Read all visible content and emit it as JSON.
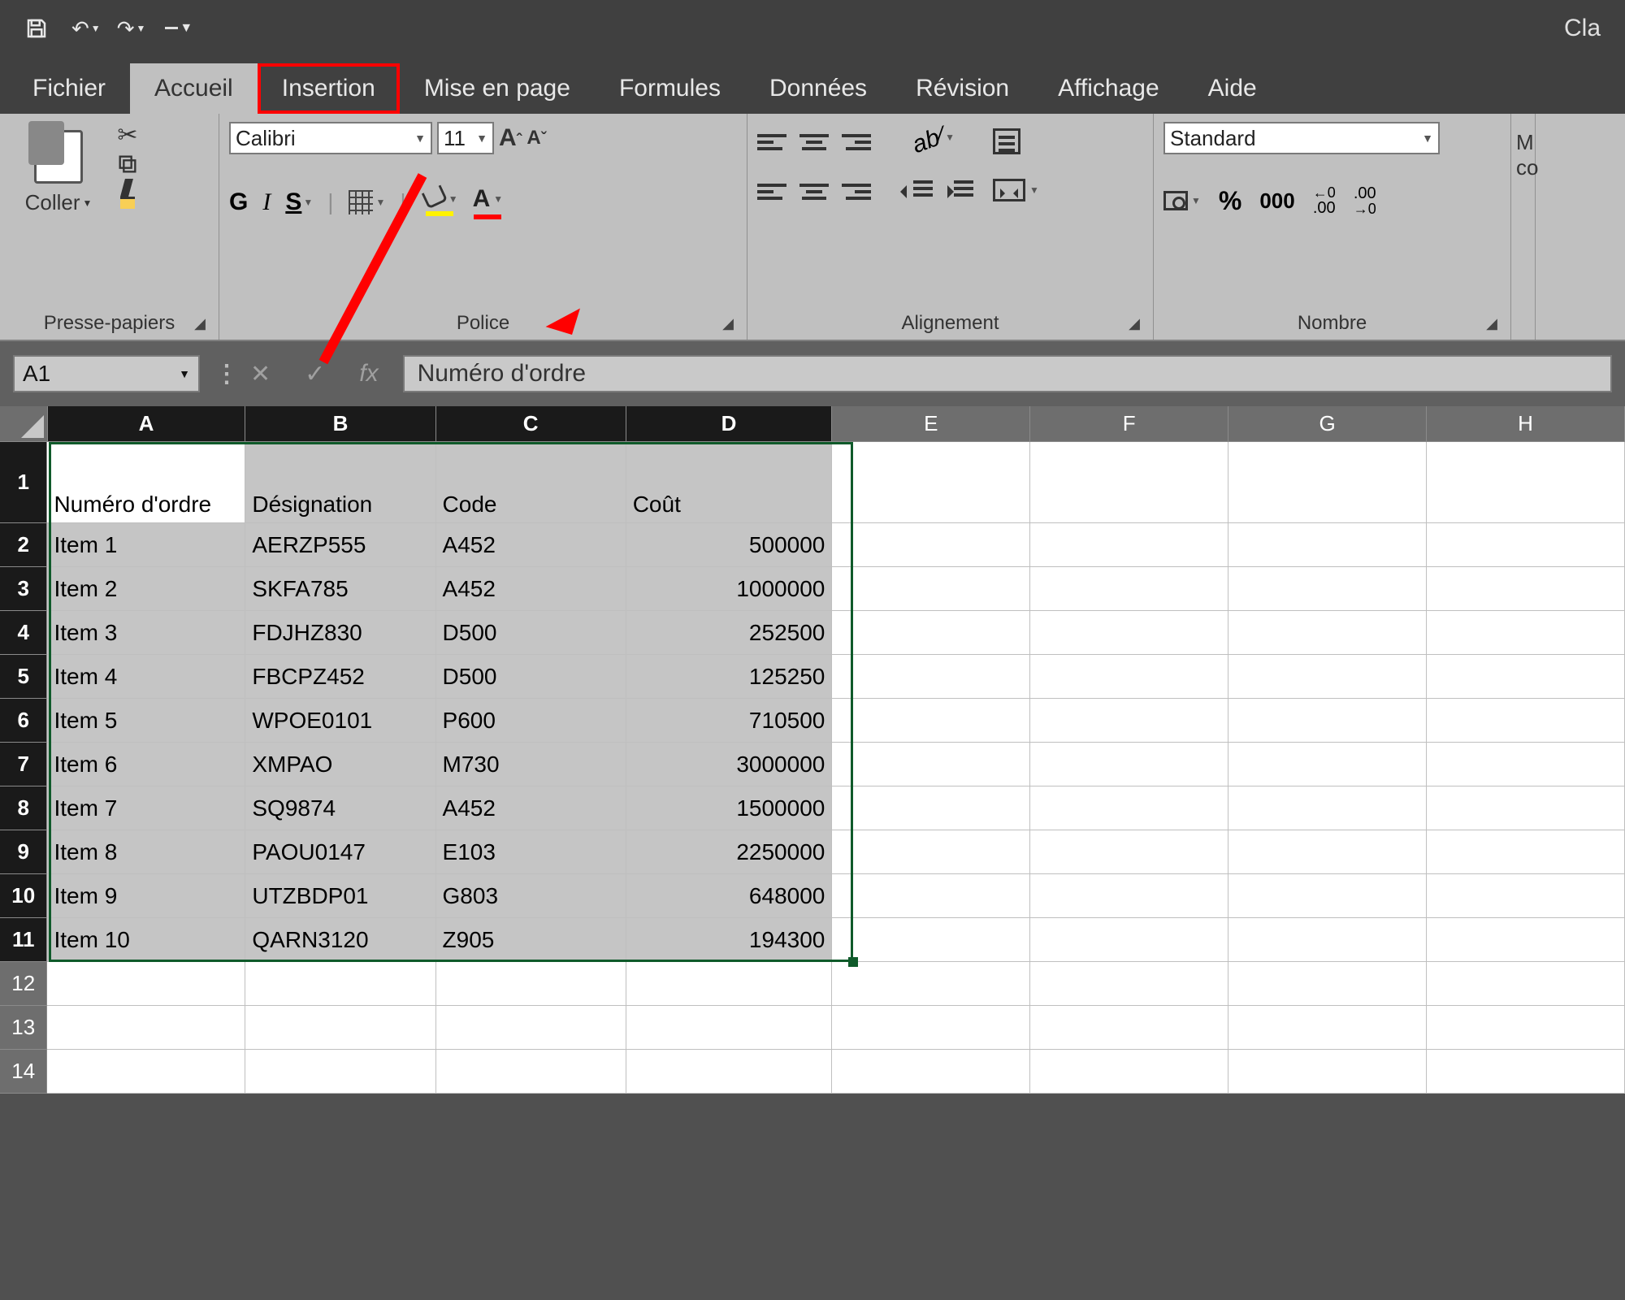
{
  "titlebar": {
    "right_text": "Cla"
  },
  "tabs": {
    "items": [
      "Fichier",
      "Accueil",
      "Insertion",
      "Mise en page",
      "Formules",
      "Données",
      "Révision",
      "Affichage",
      "Aide"
    ],
    "active_index": 1,
    "highlight_index": 2
  },
  "ribbon": {
    "clipboard": {
      "paste_label": "Coller",
      "group_label": "Presse-papiers"
    },
    "font": {
      "font_name": "Calibri",
      "font_size": "11",
      "group_label": "Police"
    },
    "alignment": {
      "group_label": "Alignement"
    },
    "number": {
      "format": "Standard",
      "percent": "%",
      "thousand": "000",
      "dec_inc": "←0\n.00",
      "dec_dec": ".00\n→0",
      "group_label": "Nombre"
    },
    "cut_right": "M\nco"
  },
  "formulabar": {
    "name_box": "A1",
    "fx_label": "fx",
    "value": "Numéro d'ordre"
  },
  "sheet": {
    "columns": [
      "A",
      "B",
      "C",
      "D",
      "E",
      "F",
      "G",
      "H"
    ],
    "selected_cols": [
      "A",
      "B",
      "C",
      "D"
    ],
    "selected_rows": [
      1,
      2,
      3,
      4,
      5,
      6,
      7,
      8,
      9,
      10,
      11
    ],
    "headers": [
      "Numéro d'ordre",
      "Désignation",
      "Code",
      "Coût"
    ],
    "rows": [
      {
        "n": 1,
        "a": "Numéro d'ordre",
        "b": "Désignation",
        "c": "Code",
        "d": "Coût",
        "is_header": true
      },
      {
        "n": 2,
        "a": "Item 1",
        "b": "AERZP555",
        "c": "A452",
        "d": "500000"
      },
      {
        "n": 3,
        "a": "Item 2",
        "b": "SKFA785",
        "c": "A452",
        "d": "1000000"
      },
      {
        "n": 4,
        "a": "Item 3",
        "b": "FDJHZ830",
        "c": "D500",
        "d": "252500"
      },
      {
        "n": 5,
        "a": "Item 4",
        "b": "FBCPZ452",
        "c": "D500",
        "d": "125250"
      },
      {
        "n": 6,
        "a": "Item 5",
        "b": "WPOE0101",
        "c": "P600",
        "d": "710500"
      },
      {
        "n": 7,
        "a": "Item 6",
        "b": "XMPAO",
        "c": "M730",
        "d": "3000000"
      },
      {
        "n": 8,
        "a": "Item 7",
        "b": "SQ9874",
        "c": "A452",
        "d": "1500000"
      },
      {
        "n": 9,
        "a": "Item 8",
        "b": "PAOU0147",
        "c": "E103",
        "d": "2250000"
      },
      {
        "n": 10,
        "a": "Item 9",
        "b": "UTZBDP01",
        "c": "G803",
        "d": "648000"
      },
      {
        "n": 11,
        "a": "Item 10",
        "b": "QARN3120",
        "c": "Z905",
        "d": "194300"
      },
      {
        "n": 12,
        "a": "",
        "b": "",
        "c": "",
        "d": ""
      },
      {
        "n": 13,
        "a": "",
        "b": "",
        "c": "",
        "d": ""
      },
      {
        "n": 14,
        "a": "",
        "b": "",
        "c": "",
        "d": ""
      }
    ]
  }
}
